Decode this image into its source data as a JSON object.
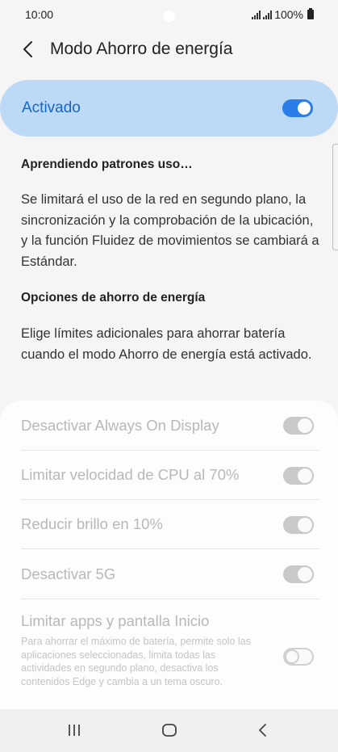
{
  "status_bar": {
    "time": "10:00",
    "battery": "100%"
  },
  "header": {
    "title": "Modo Ahorro de energía",
    "back_icon": "chevron-left-icon"
  },
  "master_toggle": {
    "label": "Activado",
    "state": "on",
    "accent_color": "#2b7de9",
    "background_color": "#bcd9f6"
  },
  "learning": {
    "heading": "Aprendiendo patrones uso…",
    "description": "Se limitará el uso de la red en segundo plano, la sincronización y la comprobación de la ubicación, y la función Fluidez de movimientos se cambiará a Estándar."
  },
  "options_section": {
    "heading": "Opciones de ahorro de energía",
    "description": "Elige límites adicionales para ahorrar batería cuando el modo Ahorro de energía está activado."
  },
  "options": [
    {
      "label": "Desactivar Always On Display",
      "state": "on",
      "enabled": false
    },
    {
      "label": "Limitar velocidad de CPU al 70%",
      "state": "on",
      "enabled": false
    },
    {
      "label": "Reducir brillo en 10%",
      "state": "on",
      "enabled": false
    },
    {
      "label": "Desactivar 5G",
      "state": "on",
      "enabled": false
    },
    {
      "label": "Limitar apps y pantalla Inicio",
      "sublabel": "Para ahorrar el máximo de batería, permite solo las aplicaciones seleccionadas, limita todas las actividades en segundo plano, desactiva los contenidos Edge y cambia a un tema oscuro.",
      "state": "off",
      "enabled": false
    }
  ],
  "nav_bar": {
    "recents_icon": "recents-icon",
    "home_icon": "home-icon",
    "back_icon": "back-icon"
  }
}
